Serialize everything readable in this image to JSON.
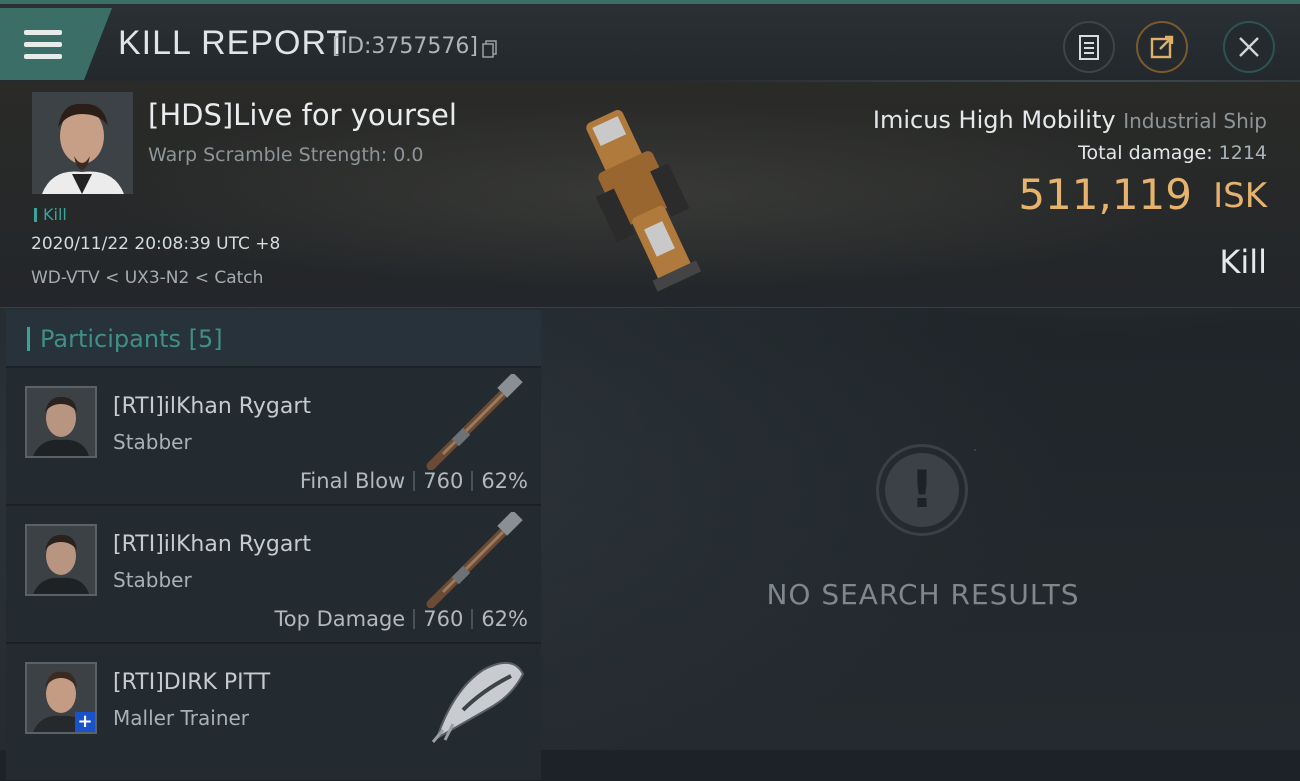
{
  "window": {
    "title": "KILL REPORT",
    "report_id": "[ID:3757576]"
  },
  "header_icons": [
    "menu-icon",
    "copy-icon",
    "clipboard-icon",
    "share-icon",
    "close-icon"
  ],
  "victim": {
    "name": "[HDS]Live for yoursel",
    "warp_scramble": "Warp Scramble Strength: 0.0",
    "kill_tag": "Kill",
    "timestamp": "2020/11/22 20:08:39 UTC +8",
    "location": "WD-VTV < UX3-N2 < Catch"
  },
  "ship": {
    "name": "Imicus High Mobility",
    "class": "Industrial Ship",
    "total_damage_label": "Total damage:",
    "total_damage": "1214",
    "value": "511,119",
    "value_unit": "ISK",
    "result": "Kill"
  },
  "participants": {
    "label": "Participants",
    "count": "[5]",
    "rows": [
      {
        "name": "[RTI]ilKhan Rygart",
        "ship": "Stabber",
        "role": "Final Blow",
        "damage": "760",
        "percent": "62%"
      },
      {
        "name": "[RTI]ilKhan Rygart",
        "ship": "Stabber",
        "role": "Top Damage",
        "damage": "760",
        "percent": "62%"
      },
      {
        "name": "[RTI]DIRK PITT",
        "ship": "Maller Trainer"
      }
    ]
  },
  "results": {
    "empty_text": "NO SEARCH RESULTS"
  },
  "colors": {
    "accent_teal": "#3aa39a",
    "isk_gold": "#e5b36d",
    "plus_badge": "#1a52c9"
  }
}
